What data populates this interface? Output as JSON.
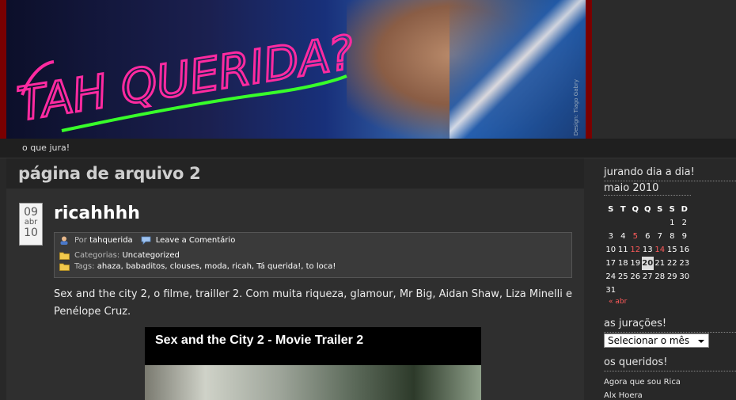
{
  "header": {
    "banner_text": "TAH QUERIDA?",
    "banner_credit": "Design: Tiago Gabry",
    "tagline": "o que jura!"
  },
  "archive": {
    "title": "página de arquivo 2"
  },
  "post": {
    "date": {
      "day": "09",
      "month": "abr",
      "year": "10"
    },
    "title": "ricahhhh",
    "author_prefix": "Por",
    "author": "tahquerida",
    "comment_link": "Leave a Comentário",
    "categories_label": "Categorias:",
    "category": "Uncategorized",
    "tags_label": "Tags:",
    "tags": "ahaza, babaditos, clouses, moda, ricah, Tá querida!, to loca!",
    "body": "Sex and the city 2, o filme, trailler 2. Com muita riqueza, glamour, Mr Big, Aidan Shaw, Liza Minelli e Penélope Cruz.",
    "video_title": "Sex and the City 2 - Movie Trailer 2"
  },
  "sidebar": {
    "calendar_title": "jurando dia a dia!",
    "calendar": {
      "caption": "maio 2010",
      "weekdays": [
        "S",
        "T",
        "Q",
        "Q",
        "S",
        "S",
        "D"
      ],
      "rows": [
        [
          "",
          "",
          "",
          "",
          "",
          "1",
          "2"
        ],
        [
          "3",
          "4",
          "5",
          "6",
          "7",
          "8",
          "9"
        ],
        [
          "10",
          "11",
          "12",
          "13",
          "14",
          "15",
          "16"
        ],
        [
          "17",
          "18",
          "19",
          "20",
          "21",
          "22",
          "23"
        ],
        [
          "24",
          "25",
          "26",
          "27",
          "28",
          "29",
          "30"
        ],
        [
          "31",
          "",
          "",
          "",
          "",
          "",
          ""
        ]
      ],
      "highlighted_days": [
        "5",
        "12",
        "14"
      ],
      "today": "20",
      "prev_link": "« abr"
    },
    "archives_title": "as jurações!",
    "archives_select": "Selecionar o mês",
    "blogroll_title": "os queridos!",
    "blogroll": [
      "Agora que sou Rica",
      "Alx Hoera"
    ]
  },
  "colors": {
    "background": "#282828",
    "highlight_red": "#ff5a5a",
    "banner_border": "#7a0000"
  }
}
